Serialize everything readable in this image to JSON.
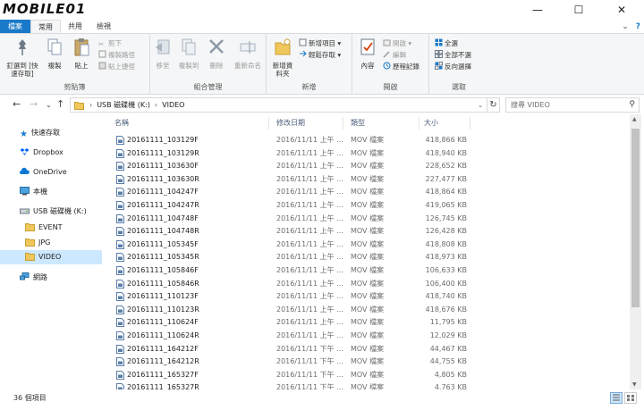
{
  "window": {
    "logo_text": "MOBILE01",
    "controls": [
      "—",
      "☐",
      "✕"
    ]
  },
  "ribbon_tabs": [
    "檔案",
    "常用",
    "共用",
    "檢視"
  ],
  "ribbon": {
    "clipboard": {
      "pin": "釘選到 [快速存取]",
      "copy": "複製",
      "paste": "貼上",
      "cut": "剪下",
      "copy_path": "複製路徑",
      "paste_shortcut": "貼上捷徑",
      "label": "剪貼簿"
    },
    "organize": {
      "move_to": "移至",
      "copy_to": "複製到",
      "delete": "刪除",
      "rename": "重新命名",
      "label": "組合管理"
    },
    "new": {
      "new_folder": "新增資料夾",
      "new_item": "新增項目",
      "easy_access": "輕鬆存取",
      "label": "新增"
    },
    "open": {
      "properties": "內容",
      "open": "開啟",
      "edit": "編輯",
      "history": "歷程記錄",
      "label": "開啟"
    },
    "select": {
      "select_all": "全選",
      "select_none": "全部不選",
      "invert": "反向選擇",
      "label": "選取"
    }
  },
  "address": {
    "path": [
      "USB 磁碟機 (K:)",
      "VIDEO"
    ],
    "search_placeholder": "搜尋 VIDEO"
  },
  "nav_pane": {
    "items": [
      {
        "label": "快速存取",
        "icon": "star-icon"
      },
      {
        "label": "Dropbox",
        "icon": "dropbox-icon"
      },
      {
        "label": "OneDrive",
        "icon": "cloud-icon"
      },
      {
        "label": "本機",
        "icon": "computer-icon"
      },
      {
        "label": "USB 磁碟機 (K:)",
        "icon": "drive-icon"
      },
      {
        "label": "EVENT",
        "icon": "folder-icon"
      },
      {
        "label": "JPG",
        "icon": "folder-icon"
      },
      {
        "label": "VIDEO",
        "icon": "folder-icon",
        "selected": true
      },
      {
        "label": "網路",
        "icon": "network-icon"
      }
    ]
  },
  "columns": [
    "名稱",
    "修改日期",
    "類型",
    "大小"
  ],
  "files": [
    {
      "name": "20161111_103129F",
      "date": "2016/11/11 上午 ...",
      "type": "MOV 檔案",
      "size": "418,866 KB"
    },
    {
      "name": "20161111_103129R",
      "date": "2016/11/11 上午 ...",
      "type": "MOV 檔案",
      "size": "418,940 KB"
    },
    {
      "name": "20161111_103630F",
      "date": "2016/11/11 上午 ...",
      "type": "MOV 檔案",
      "size": "228,652 KB"
    },
    {
      "name": "20161111_103630R",
      "date": "2016/11/11 上午 ...",
      "type": "MOV 檔案",
      "size": "227,477 KB"
    },
    {
      "name": "20161111_104247F",
      "date": "2016/11/11 上午 ...",
      "type": "MOV 檔案",
      "size": "418,864 KB"
    },
    {
      "name": "20161111_104247R",
      "date": "2016/11/11 上午 ...",
      "type": "MOV 檔案",
      "size": "419,065 KB"
    },
    {
      "name": "20161111_104748F",
      "date": "2016/11/11 上午 ...",
      "type": "MOV 檔案",
      "size": "126,745 KB"
    },
    {
      "name": "20161111_104748R",
      "date": "2016/11/11 上午 ...",
      "type": "MOV 檔案",
      "size": "126,428 KB"
    },
    {
      "name": "20161111_105345F",
      "date": "2016/11/11 上午 ...",
      "type": "MOV 檔案",
      "size": "418,808 KB"
    },
    {
      "name": "20161111_105345R",
      "date": "2016/11/11 上午 ...",
      "type": "MOV 檔案",
      "size": "418,973 KB"
    },
    {
      "name": "20161111_105846F",
      "date": "2016/11/11 上午 ...",
      "type": "MOV 檔案",
      "size": "106,633 KB"
    },
    {
      "name": "20161111_105846R",
      "date": "2016/11/11 上午 ...",
      "type": "MOV 檔案",
      "size": "106,400 KB"
    },
    {
      "name": "20161111_110123F",
      "date": "2016/11/11 上午 ...",
      "type": "MOV 檔案",
      "size": "418,740 KB"
    },
    {
      "name": "20161111_110123R",
      "date": "2016/11/11 上午 ...",
      "type": "MOV 檔案",
      "size": "418,676 KB"
    },
    {
      "name": "20161111_110624F",
      "date": "2016/11/11 上午 ...",
      "type": "MOV 檔案",
      "size": "11,795 KB"
    },
    {
      "name": "20161111_110624R",
      "date": "2016/11/11 上午 ...",
      "type": "MOV 檔案",
      "size": "12,029 KB"
    },
    {
      "name": "20161111_164212F",
      "date": "2016/11/11 下午 ...",
      "type": "MOV 檔案",
      "size": "44,467 KB"
    },
    {
      "name": "20161111_164212R",
      "date": "2016/11/11 下午 ...",
      "type": "MOV 檔案",
      "size": "44,755 KB"
    },
    {
      "name": "20161111_165327F",
      "date": "2016/11/11 下午 ...",
      "type": "MOV 檔案",
      "size": "4,805 KB"
    },
    {
      "name": "20161111_165327R",
      "date": "2016/11/11 下午 ...",
      "type": "MOV 檔案",
      "size": "4,763 KB"
    }
  ],
  "status": {
    "item_count": "36 個項目"
  },
  "colors": {
    "file_tab": "#1979ca",
    "selection": "#cce8ff",
    "header_text": "#4c607a"
  }
}
